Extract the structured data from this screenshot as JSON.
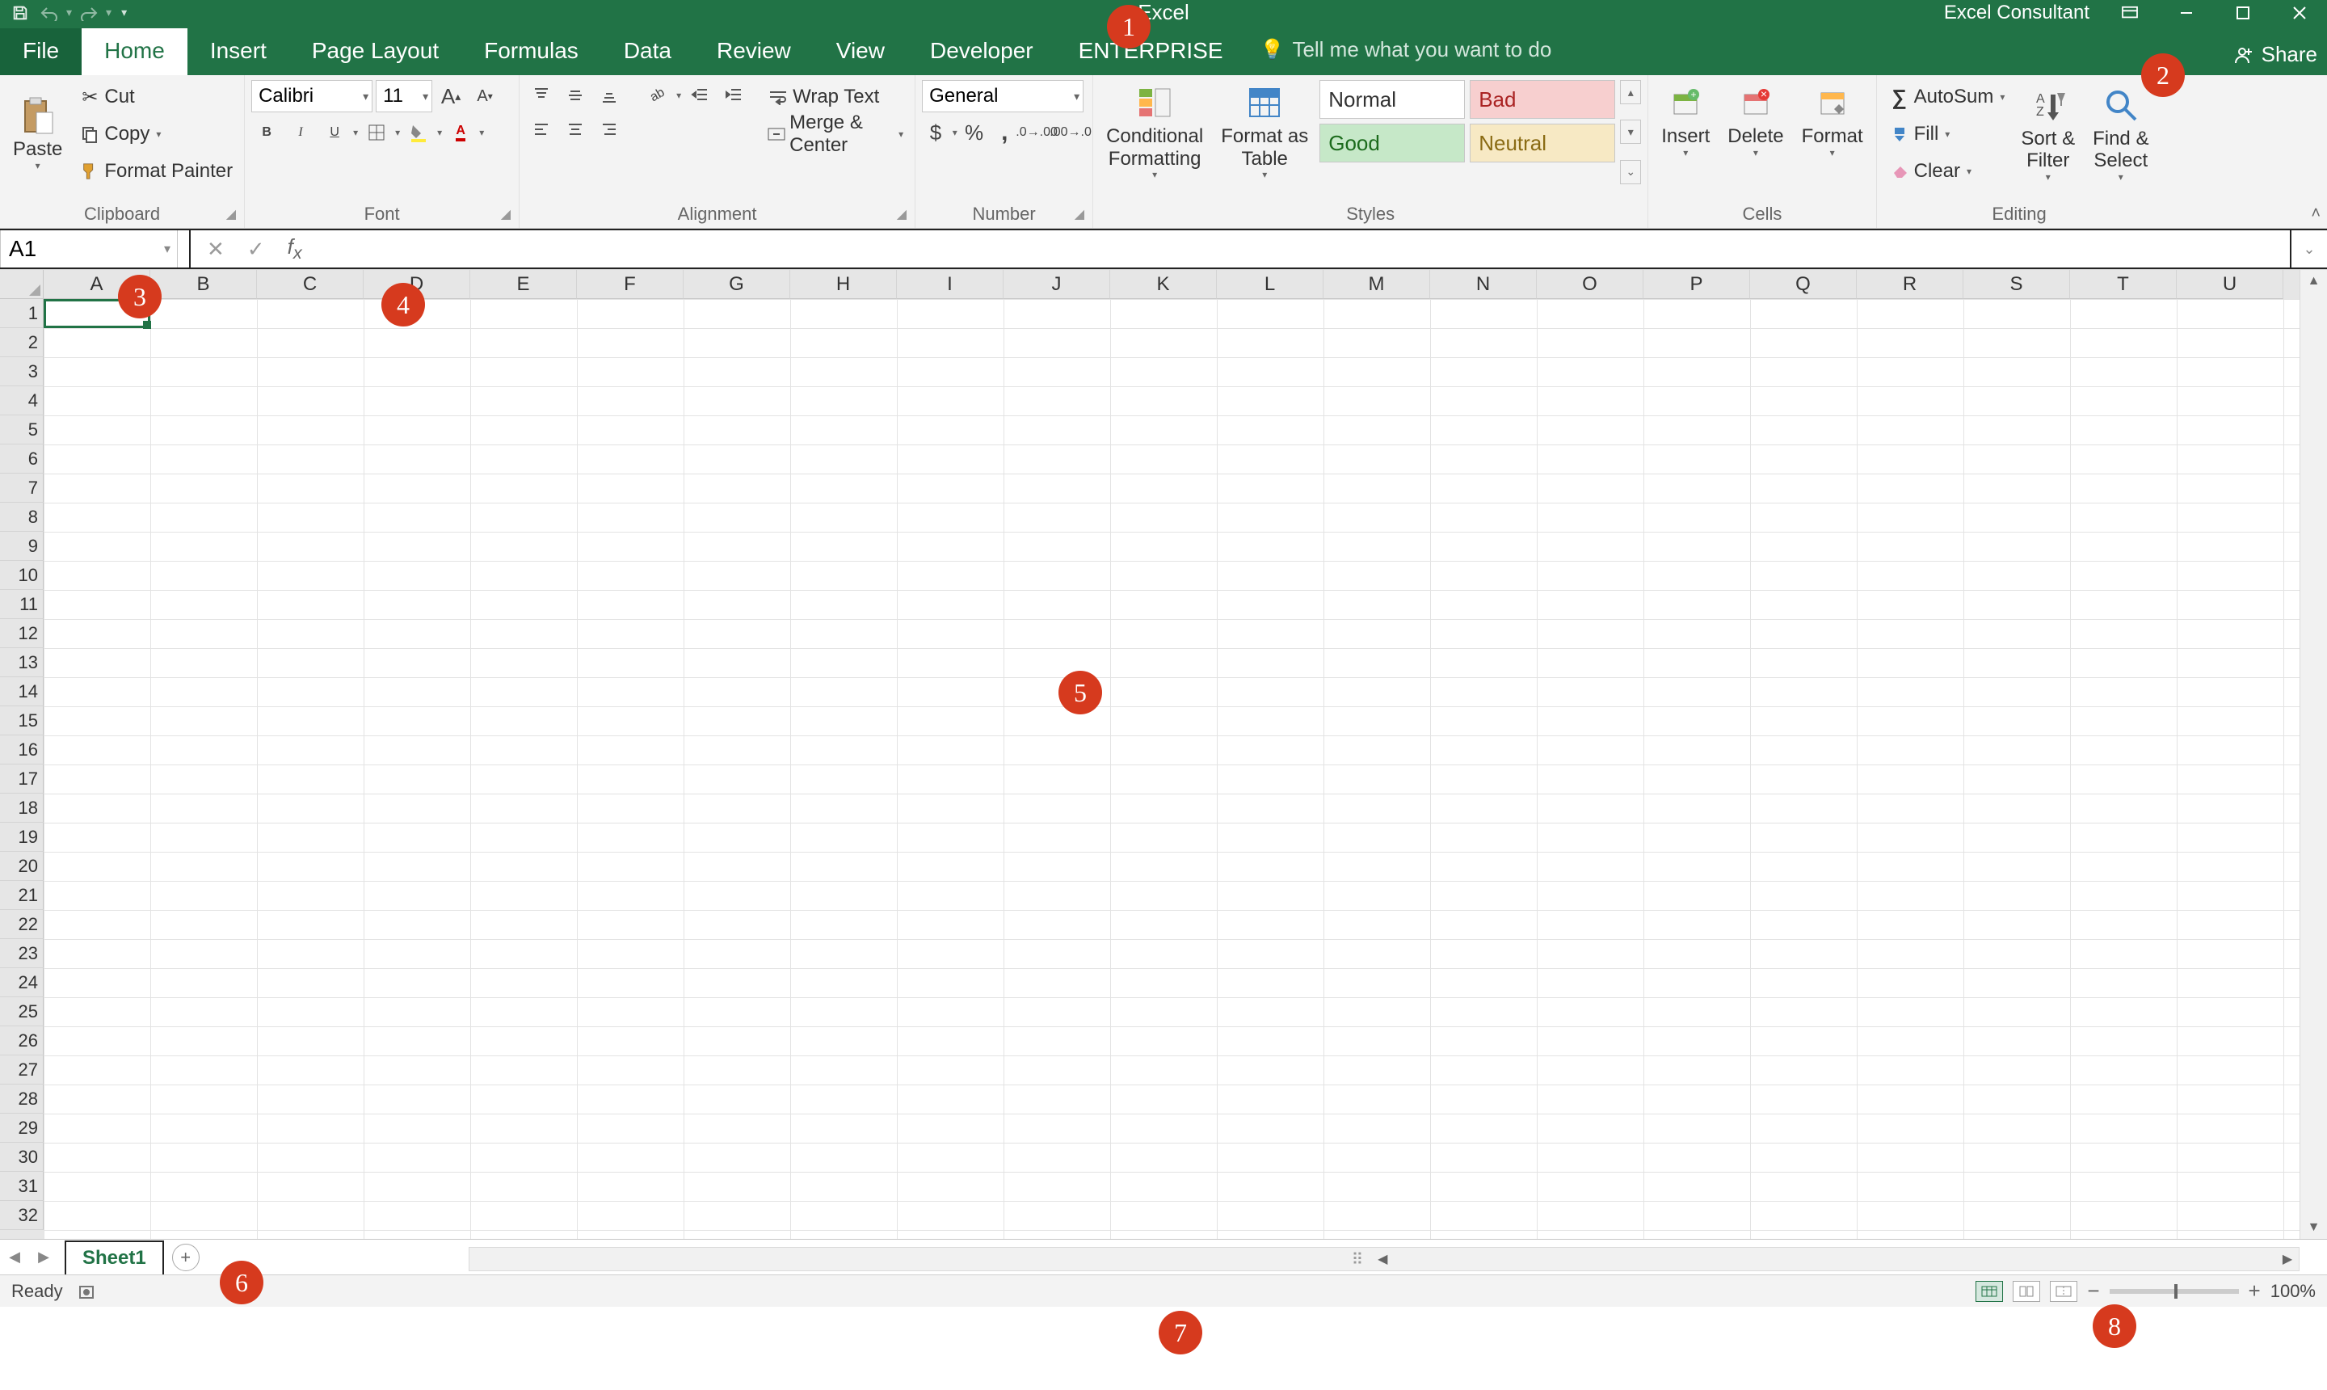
{
  "titlebar": {
    "app_title": "Excel",
    "user_name": "Excel Consultant"
  },
  "tabs": {
    "file": "File",
    "items": [
      "Home",
      "Insert",
      "Page Layout",
      "Formulas",
      "Data",
      "Review",
      "View",
      "Developer",
      "ENTERPRISE"
    ],
    "active": "Home",
    "tellme": "Tell me what you want to do",
    "share": "Share"
  },
  "ribbon": {
    "clipboard": {
      "paste": "Paste",
      "cut": "Cut",
      "copy": "Copy",
      "format_painter": "Format Painter",
      "label": "Clipboard"
    },
    "font": {
      "name": "Calibri",
      "size": "11",
      "label": "Font"
    },
    "alignment": {
      "wrap": "Wrap Text",
      "merge": "Merge & Center",
      "label": "Alignment"
    },
    "number": {
      "format": "General",
      "label": "Number"
    },
    "styles": {
      "cond_fmt": "Conditional\nFormatting",
      "fmt_table": "Format as\nTable",
      "normal": "Normal",
      "bad": "Bad",
      "good": "Good",
      "neutral": "Neutral",
      "label": "Styles"
    },
    "cells": {
      "insert": "Insert",
      "delete": "Delete",
      "format": "Format",
      "label": "Cells"
    },
    "editing": {
      "autosum": "AutoSum",
      "fill": "Fill",
      "clear": "Clear",
      "sort": "Sort &\nFilter",
      "find": "Find &\nSelect",
      "label": "Editing"
    }
  },
  "formula_bar": {
    "name_box": "A1",
    "formula": ""
  },
  "grid": {
    "columns": [
      "A",
      "B",
      "C",
      "D",
      "E",
      "F",
      "G",
      "H",
      "I",
      "J",
      "K",
      "L",
      "M",
      "N",
      "O",
      "P",
      "Q",
      "R",
      "S",
      "T",
      "U"
    ],
    "row_count": 32,
    "selected_cell": "A1"
  },
  "sheets": {
    "active": "Sheet1"
  },
  "statusbar": {
    "status": "Ready",
    "zoom": "100%"
  },
  "callouts": [
    "1",
    "2",
    "3",
    "4",
    "5",
    "6",
    "7",
    "8"
  ]
}
